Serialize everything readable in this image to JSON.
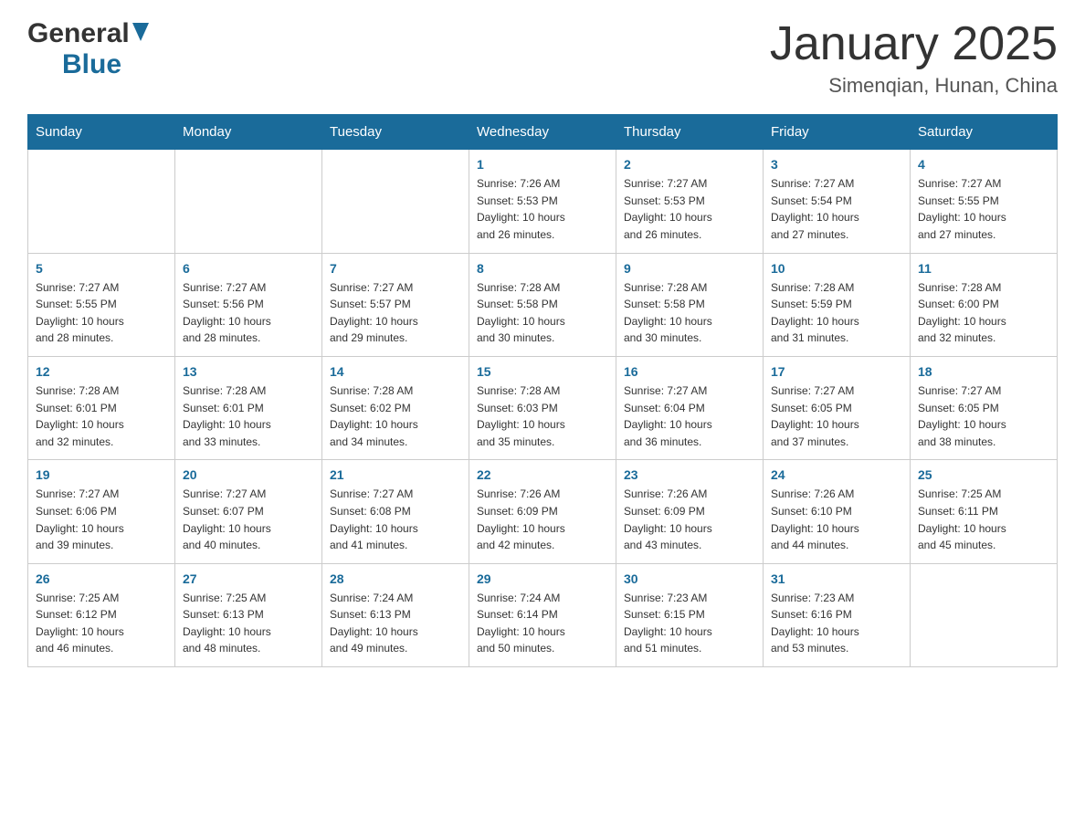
{
  "header": {
    "logo_general": "General",
    "logo_blue": "Blue",
    "month_title": "January 2025",
    "location": "Simenqian, Hunan, China"
  },
  "weekdays": [
    "Sunday",
    "Monday",
    "Tuesday",
    "Wednesday",
    "Thursday",
    "Friday",
    "Saturday"
  ],
  "weeks": [
    [
      {
        "num": "",
        "info": ""
      },
      {
        "num": "",
        "info": ""
      },
      {
        "num": "",
        "info": ""
      },
      {
        "num": "1",
        "info": "Sunrise: 7:26 AM\nSunset: 5:53 PM\nDaylight: 10 hours\nand 26 minutes."
      },
      {
        "num": "2",
        "info": "Sunrise: 7:27 AM\nSunset: 5:53 PM\nDaylight: 10 hours\nand 26 minutes."
      },
      {
        "num": "3",
        "info": "Sunrise: 7:27 AM\nSunset: 5:54 PM\nDaylight: 10 hours\nand 27 minutes."
      },
      {
        "num": "4",
        "info": "Sunrise: 7:27 AM\nSunset: 5:55 PM\nDaylight: 10 hours\nand 27 minutes."
      }
    ],
    [
      {
        "num": "5",
        "info": "Sunrise: 7:27 AM\nSunset: 5:55 PM\nDaylight: 10 hours\nand 28 minutes."
      },
      {
        "num": "6",
        "info": "Sunrise: 7:27 AM\nSunset: 5:56 PM\nDaylight: 10 hours\nand 28 minutes."
      },
      {
        "num": "7",
        "info": "Sunrise: 7:27 AM\nSunset: 5:57 PM\nDaylight: 10 hours\nand 29 minutes."
      },
      {
        "num": "8",
        "info": "Sunrise: 7:28 AM\nSunset: 5:58 PM\nDaylight: 10 hours\nand 30 minutes."
      },
      {
        "num": "9",
        "info": "Sunrise: 7:28 AM\nSunset: 5:58 PM\nDaylight: 10 hours\nand 30 minutes."
      },
      {
        "num": "10",
        "info": "Sunrise: 7:28 AM\nSunset: 5:59 PM\nDaylight: 10 hours\nand 31 minutes."
      },
      {
        "num": "11",
        "info": "Sunrise: 7:28 AM\nSunset: 6:00 PM\nDaylight: 10 hours\nand 32 minutes."
      }
    ],
    [
      {
        "num": "12",
        "info": "Sunrise: 7:28 AM\nSunset: 6:01 PM\nDaylight: 10 hours\nand 32 minutes."
      },
      {
        "num": "13",
        "info": "Sunrise: 7:28 AM\nSunset: 6:01 PM\nDaylight: 10 hours\nand 33 minutes."
      },
      {
        "num": "14",
        "info": "Sunrise: 7:28 AM\nSunset: 6:02 PM\nDaylight: 10 hours\nand 34 minutes."
      },
      {
        "num": "15",
        "info": "Sunrise: 7:28 AM\nSunset: 6:03 PM\nDaylight: 10 hours\nand 35 minutes."
      },
      {
        "num": "16",
        "info": "Sunrise: 7:27 AM\nSunset: 6:04 PM\nDaylight: 10 hours\nand 36 minutes."
      },
      {
        "num": "17",
        "info": "Sunrise: 7:27 AM\nSunset: 6:05 PM\nDaylight: 10 hours\nand 37 minutes."
      },
      {
        "num": "18",
        "info": "Sunrise: 7:27 AM\nSunset: 6:05 PM\nDaylight: 10 hours\nand 38 minutes."
      }
    ],
    [
      {
        "num": "19",
        "info": "Sunrise: 7:27 AM\nSunset: 6:06 PM\nDaylight: 10 hours\nand 39 minutes."
      },
      {
        "num": "20",
        "info": "Sunrise: 7:27 AM\nSunset: 6:07 PM\nDaylight: 10 hours\nand 40 minutes."
      },
      {
        "num": "21",
        "info": "Sunrise: 7:27 AM\nSunset: 6:08 PM\nDaylight: 10 hours\nand 41 minutes."
      },
      {
        "num": "22",
        "info": "Sunrise: 7:26 AM\nSunset: 6:09 PM\nDaylight: 10 hours\nand 42 minutes."
      },
      {
        "num": "23",
        "info": "Sunrise: 7:26 AM\nSunset: 6:09 PM\nDaylight: 10 hours\nand 43 minutes."
      },
      {
        "num": "24",
        "info": "Sunrise: 7:26 AM\nSunset: 6:10 PM\nDaylight: 10 hours\nand 44 minutes."
      },
      {
        "num": "25",
        "info": "Sunrise: 7:25 AM\nSunset: 6:11 PM\nDaylight: 10 hours\nand 45 minutes."
      }
    ],
    [
      {
        "num": "26",
        "info": "Sunrise: 7:25 AM\nSunset: 6:12 PM\nDaylight: 10 hours\nand 46 minutes."
      },
      {
        "num": "27",
        "info": "Sunrise: 7:25 AM\nSunset: 6:13 PM\nDaylight: 10 hours\nand 48 minutes."
      },
      {
        "num": "28",
        "info": "Sunrise: 7:24 AM\nSunset: 6:13 PM\nDaylight: 10 hours\nand 49 minutes."
      },
      {
        "num": "29",
        "info": "Sunrise: 7:24 AM\nSunset: 6:14 PM\nDaylight: 10 hours\nand 50 minutes."
      },
      {
        "num": "30",
        "info": "Sunrise: 7:23 AM\nSunset: 6:15 PM\nDaylight: 10 hours\nand 51 minutes."
      },
      {
        "num": "31",
        "info": "Sunrise: 7:23 AM\nSunset: 6:16 PM\nDaylight: 10 hours\nand 53 minutes."
      },
      {
        "num": "",
        "info": ""
      }
    ]
  ]
}
